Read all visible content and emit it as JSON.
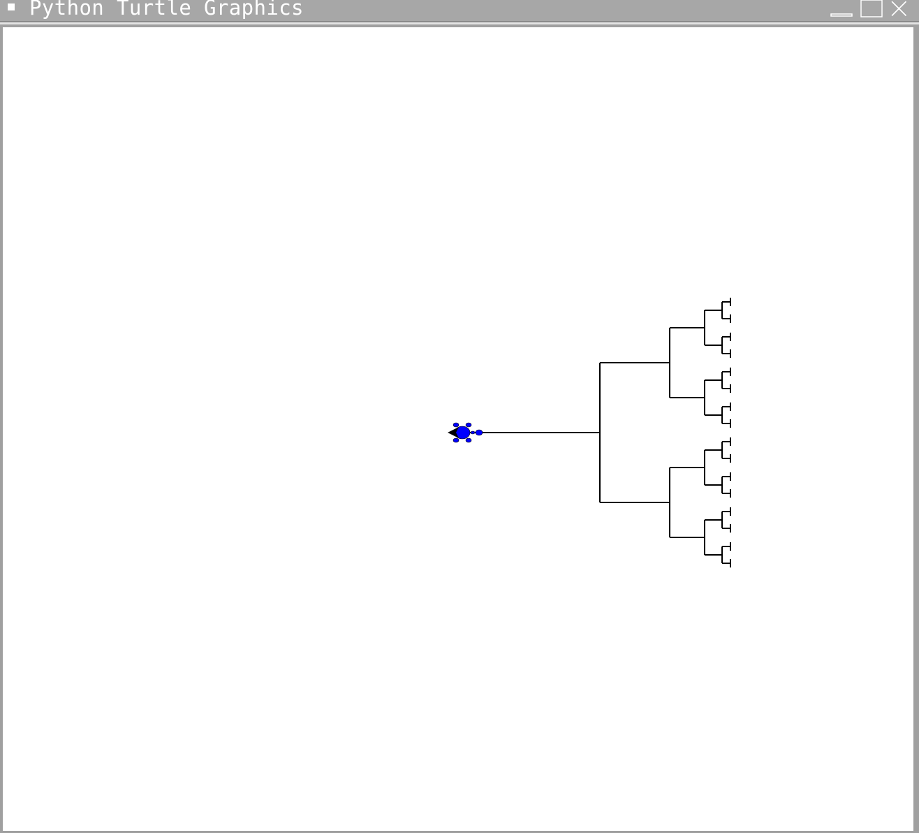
{
  "window": {
    "title": "Python Turtle Graphics",
    "controls": {
      "minimize_icon": "minimize-icon",
      "maximize_icon": "maximize-icon",
      "close_icon": "close-icon"
    }
  },
  "canvas": {
    "background": "#ffffff",
    "pen_color": "#000000",
    "turtle": {
      "shape": "turtle",
      "fill_color": "#0000ff",
      "outline_color": "#000000",
      "heading": "west"
    }
  }
}
